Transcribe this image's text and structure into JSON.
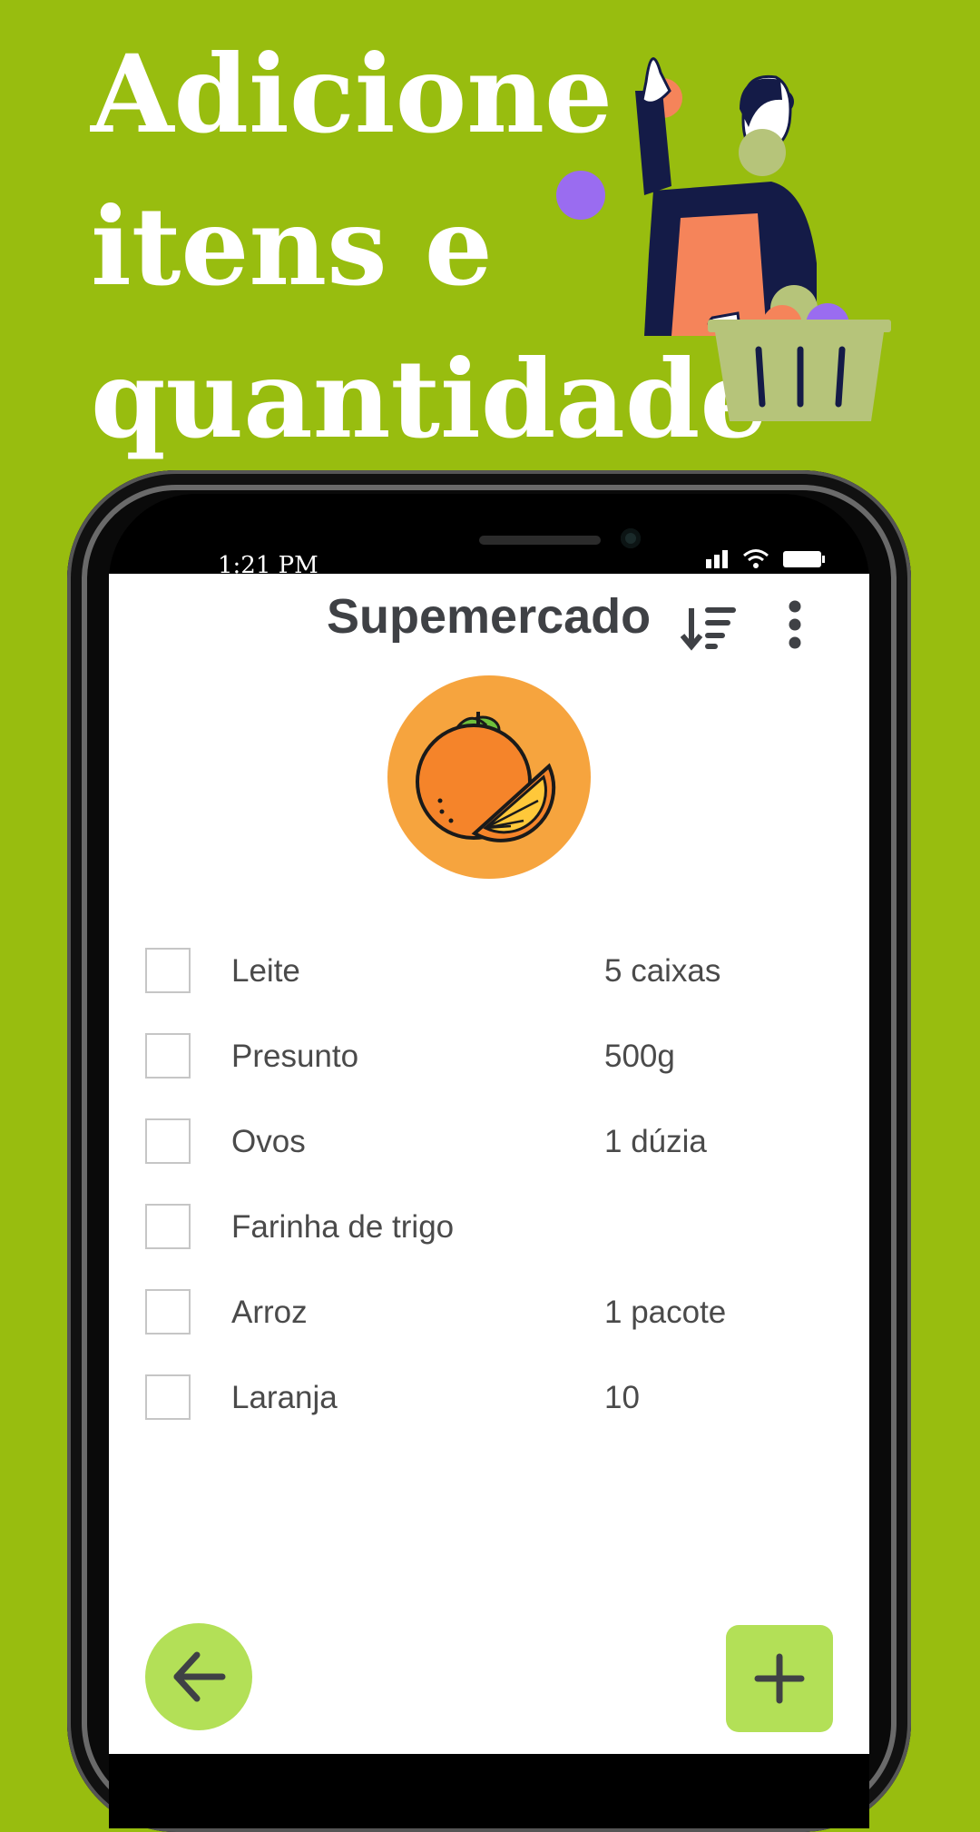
{
  "headline": {
    "lines": [
      "Adicione",
      "itens e",
      "quantidade"
    ]
  },
  "status_bar": {
    "time": "1:21 PM",
    "icons": [
      "signal-icon",
      "wifi-icon",
      "battery-icon"
    ]
  },
  "app": {
    "title": "Supemercado",
    "actions": [
      "sort-icon",
      "more-vert-icon"
    ],
    "logo_icon": "orange-fruit-icon"
  },
  "items": [
    {
      "name": "Leite",
      "quantity": "5 caixas",
      "checked": false
    },
    {
      "name": "Presunto",
      "quantity": "500g",
      "checked": false
    },
    {
      "name": "Ovos",
      "quantity": "1 dúzia",
      "checked": false
    },
    {
      "name": "Farinha de trigo",
      "quantity": "",
      "checked": false
    },
    {
      "name": "Arroz",
      "quantity": "1 pacote",
      "checked": false
    },
    {
      "name": "Laranja",
      "quantity": "10",
      "checked": false
    }
  ],
  "buttons": {
    "back_icon": "arrow-left-icon",
    "add_icon": "plus-icon"
  },
  "colors": {
    "background": "#98bd0f",
    "accent": "#b3e057",
    "logo_bg": "#f6a43e",
    "text": "#3f4145"
  }
}
